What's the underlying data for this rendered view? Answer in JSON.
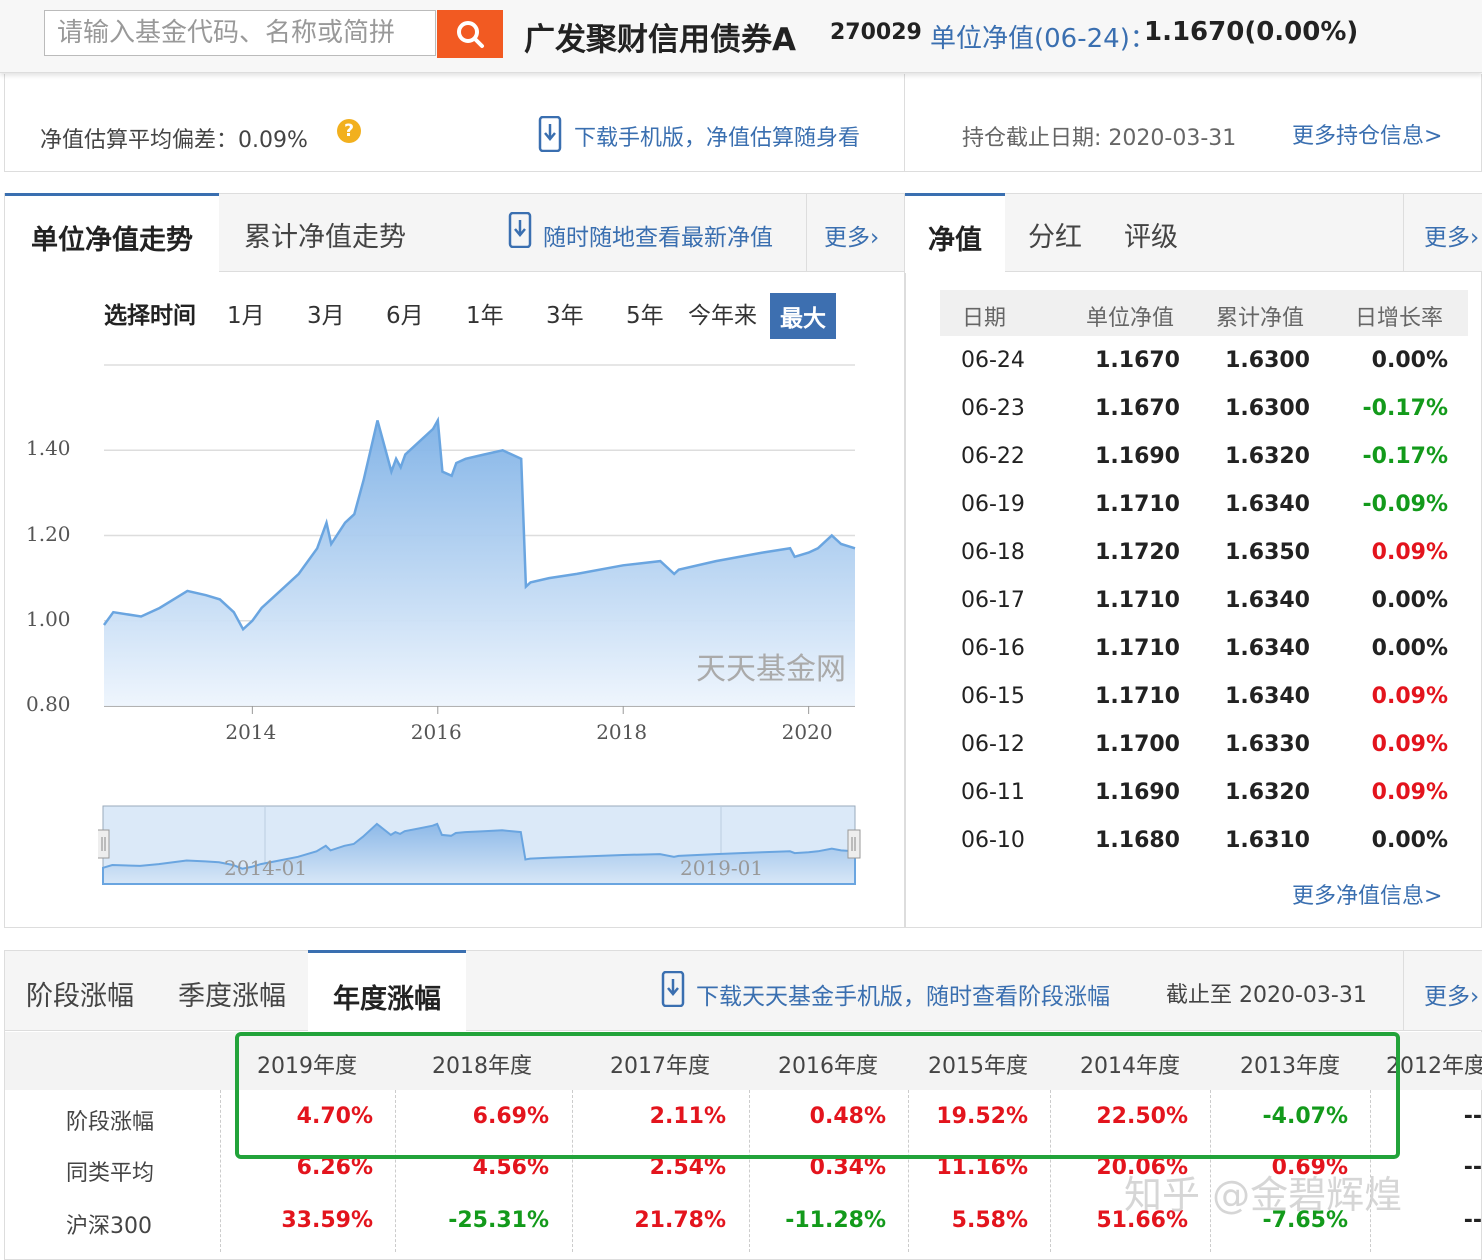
{
  "header": {
    "search_placeholder": "请输入基金代码、名称或简拼",
    "fund_name": "广发聚财信用债券A",
    "fund_code": "270029",
    "nav_label": "单位净值(06-24)：",
    "nav_value": "1.1670(0.00%)"
  },
  "info": {
    "avg_deviation_label": "净值估算平均偏差：",
    "avg_deviation_value": "0.09%",
    "download_text": "下载手机版，净值估算随身看",
    "holding_date": "持仓截止日期: 2020-03-31",
    "more_holding": "更多持仓信息>"
  },
  "chart_panel": {
    "tab_unit": "单位净值走势",
    "tab_cumulative": "累计净值走势",
    "mobile_text": "随时随地查看最新净值",
    "more": "更多",
    "range_label": "选择时间",
    "ranges": [
      "1月",
      "3月",
      "6月",
      "1年",
      "3年",
      "5年",
      "今年来",
      "最大"
    ],
    "watermark": "天天基金网",
    "navigator_labels": [
      "2014-01",
      "2019-01"
    ]
  },
  "chart_data": {
    "type": "area",
    "x_ticks": [
      "2014",
      "2016",
      "2018",
      "2020"
    ],
    "y_ticks": [
      "0.80",
      "1.00",
      "1.20",
      "1.40"
    ],
    "ylim": [
      0.8,
      1.6
    ],
    "xlim": [
      2012.4,
      2020.5
    ],
    "series": [
      {
        "x": [
          2012.4,
          2012.5,
          2012.8,
          2013.0,
          2013.3,
          2013.5,
          2013.65,
          2013.8,
          2013.9,
          2014.0,
          2014.1,
          2014.3,
          2014.5,
          2014.7,
          2014.8,
          2014.85,
          2015.0,
          2015.1,
          2015.2,
          2015.35,
          2015.5,
          2015.55,
          2015.6,
          2015.65,
          2015.8,
          2015.95,
          2016.0,
          2016.05,
          2016.15,
          2016.2,
          2016.3,
          2016.5,
          2016.7,
          2016.9,
          2016.95,
          2017.0,
          2017.2,
          2017.5,
          2018.0,
          2018.4,
          2018.55,
          2018.6,
          2019.0,
          2019.5,
          2019.8,
          2019.85,
          2020.0,
          2020.1,
          2020.25,
          2020.35,
          2020.5
        ],
        "values": [
          0.99,
          1.02,
          1.01,
          1.03,
          1.07,
          1.06,
          1.05,
          1.02,
          0.98,
          1.0,
          1.03,
          1.07,
          1.11,
          1.17,
          1.23,
          1.18,
          1.23,
          1.25,
          1.33,
          1.47,
          1.35,
          1.38,
          1.36,
          1.39,
          1.42,
          1.45,
          1.47,
          1.35,
          1.34,
          1.37,
          1.38,
          1.39,
          1.4,
          1.38,
          1.08,
          1.09,
          1.1,
          1.11,
          1.13,
          1.14,
          1.11,
          1.12,
          1.14,
          1.16,
          1.17,
          1.15,
          1.16,
          1.17,
          1.2,
          1.18,
          1.17
        ]
      }
    ]
  },
  "nav_panel": {
    "tabs": [
      "净值",
      "分红",
      "评级"
    ],
    "more": "更多",
    "columns": [
      "日期",
      "单位净值",
      "累计净值",
      "日增长率"
    ],
    "rows": [
      {
        "date": "06-24",
        "unit": "1.1670",
        "cum": "1.6300",
        "rate": "0.00%",
        "dir": "zero"
      },
      {
        "date": "06-23",
        "unit": "1.1670",
        "cum": "1.6300",
        "rate": "-0.17%",
        "dir": "down"
      },
      {
        "date": "06-22",
        "unit": "1.1690",
        "cum": "1.6320",
        "rate": "-0.17%",
        "dir": "down"
      },
      {
        "date": "06-19",
        "unit": "1.1710",
        "cum": "1.6340",
        "rate": "-0.09%",
        "dir": "down"
      },
      {
        "date": "06-18",
        "unit": "1.1720",
        "cum": "1.6350",
        "rate": "0.09%",
        "dir": "up"
      },
      {
        "date": "06-17",
        "unit": "1.1710",
        "cum": "1.6340",
        "rate": "0.00%",
        "dir": "zero"
      },
      {
        "date": "06-16",
        "unit": "1.1710",
        "cum": "1.6340",
        "rate": "0.00%",
        "dir": "zero"
      },
      {
        "date": "06-15",
        "unit": "1.1710",
        "cum": "1.6340",
        "rate": "0.09%",
        "dir": "up"
      },
      {
        "date": "06-12",
        "unit": "1.1700",
        "cum": "1.6330",
        "rate": "0.09%",
        "dir": "up"
      },
      {
        "date": "06-11",
        "unit": "1.1690",
        "cum": "1.6320",
        "rate": "0.09%",
        "dir": "up"
      },
      {
        "date": "06-10",
        "unit": "1.1680",
        "cum": "1.6310",
        "rate": "0.00%",
        "dir": "zero"
      }
    ],
    "more_nav": "更多净值信息>"
  },
  "returns_panel": {
    "tabs": [
      "阶段涨幅",
      "季度涨幅",
      "年度涨幅"
    ],
    "download_text": "下载天天基金手机版，随时查看阶段涨幅",
    "as_of": "截止至  2020-03-31",
    "more": "更多",
    "years": [
      "2019年度",
      "2018年度",
      "2017年度",
      "2016年度",
      "2015年度",
      "2014年度",
      "2013年度",
      "2012年度"
    ],
    "rows": [
      {
        "label": "阶段涨幅",
        "values": [
          "4.70%",
          "6.69%",
          "2.11%",
          "0.48%",
          "19.52%",
          "22.50%",
          "-4.07%",
          "--"
        ]
      },
      {
        "label": "同类平均",
        "values": [
          "6.26%",
          "4.56%",
          "2.54%",
          "0.34%",
          "11.16%",
          "20.06%",
          "0.69%",
          "--"
        ]
      },
      {
        "label": "沪深300",
        "values": [
          "33.59%",
          "-25.31%",
          "21.78%",
          "-11.28%",
          "5.58%",
          "51.66%",
          "-7.65%",
          "--"
        ]
      }
    ],
    "zhihu_watermark": "知乎 @金碧辉煌"
  },
  "colors": {
    "accent": "#3a6fb0",
    "search_button": "#f25a22",
    "up": "#e3141d",
    "down": "#139a1b",
    "highlight_box": "#22a33a"
  }
}
